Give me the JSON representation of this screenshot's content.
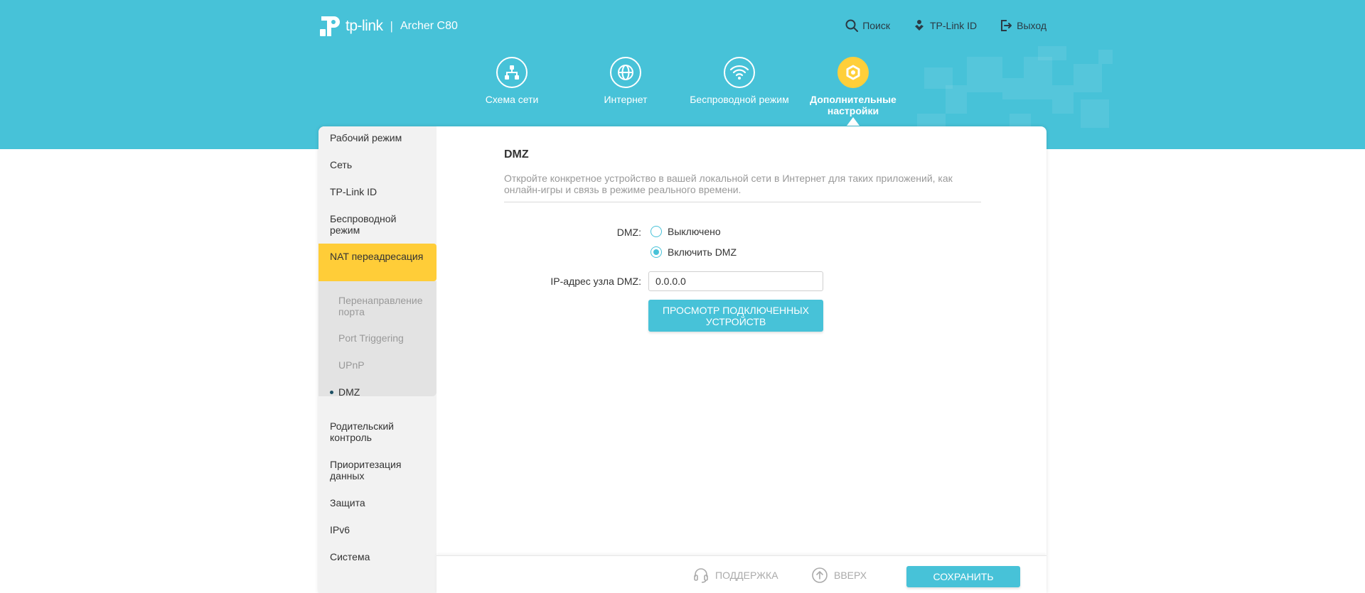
{
  "header": {
    "brand": "tp-link",
    "separator": "|",
    "model": "Archer C80",
    "actions": [
      {
        "label": "Поиск",
        "icon": "search-icon"
      },
      {
        "label": "TP-Link ID",
        "icon": "tplink-id-icon"
      },
      {
        "label": "Выход",
        "icon": "logout-icon"
      }
    ]
  },
  "nav": {
    "tabs": [
      {
        "label": "Схема сети",
        "icon": "network-map-icon"
      },
      {
        "label": "Интернет",
        "icon": "globe-icon"
      },
      {
        "label": "Беспроводной режим",
        "icon": "wifi-icon"
      },
      {
        "label": "Дополнительные настройки",
        "icon": "gear-icon",
        "active": true
      }
    ]
  },
  "sidebar": {
    "items": [
      {
        "label": "Рабочий режим"
      },
      {
        "label": "Сеть"
      },
      {
        "label": "TP-Link ID"
      },
      {
        "label": "Беспроводной режим"
      },
      {
        "label": "NAT переадресация",
        "active": true
      },
      {
        "label": "Родительский контроль"
      },
      {
        "label": "Приоритезация данных"
      },
      {
        "label": "Защита"
      },
      {
        "label": "IPv6"
      },
      {
        "label": "Система"
      }
    ],
    "sub_items": [
      {
        "label": "Перенаправление порта"
      },
      {
        "label": "Port Triggering"
      },
      {
        "label": "UPnP"
      },
      {
        "label": "DMZ",
        "active": true
      }
    ]
  },
  "main": {
    "title": "DMZ",
    "description": "Откройте конкретное устройство в вашей локальной сети в Интернет для таких приложений, как онлайн-игры и связь в режиме реального времени.",
    "dmz_label": "DMZ:",
    "options": [
      {
        "label": "Выключено",
        "checked": false
      },
      {
        "label": "Включить DMZ",
        "checked": true
      }
    ],
    "ip_label": "IP-адрес узла DMZ:",
    "ip_value": "0.0.0.0",
    "view_button": "ПРОСМОТР ПОДКЛЮЧЕННЫХ УСТРОЙСТВ"
  },
  "footer": {
    "support": "ПОДДЕРЖКА",
    "top": "ВВЕРХ",
    "save": "СОХРАНИТЬ"
  },
  "colors": {
    "accent": "#47c2d8",
    "active": "#ffcd38"
  }
}
